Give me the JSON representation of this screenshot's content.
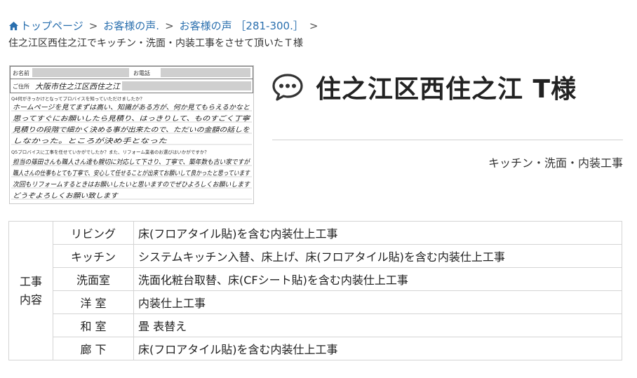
{
  "breadcrumb": {
    "items": [
      {
        "label": "トップページ"
      },
      {
        "label": "お客様の声."
      },
      {
        "label": "お客様の声 ［281-300.］"
      }
    ],
    "current": "住之江区西住之江でキッチン・洗面・内装工事をさせて頂いたＴ様"
  },
  "questionnaire": {
    "name_label": "お名前",
    "phone_label": "お電話",
    "address_label": "ご住所",
    "address_value": "大阪市住之江区西住之江",
    "q4": "Q4何がきっかけとなってプロバイスを知っていただけましたか？",
    "a4": [
      "ホームページを見てまずは高い、知識がある方が、何か見てもらえるかなと",
      "思ってすぐにお願いしたら見積り、はっきりして、ものすごく丁寧",
      "見積りの段階で細かく決める事が出来たので、ただいの金額の話しを",
      "しなかった。ところが決め手となった"
    ],
    "q5": "Q5プロバイスに工事を任せていかがでしたか？また、リフォーム業者のお選びはいかがですか？",
    "a5": [
      "担当の篠田さんも職人さん達も親切に対応して下さり、丁寧で、築年数も古い家ですが",
      "職人さんの仕事もとても丁寧で、安心して任せることが出来てお願いして良かったと思っています",
      "次回もリフォームするときはお願いしたいと思いますのでぜひよろしくお願いします",
      "どうぞよろしくお願い致します"
    ]
  },
  "voice": {
    "title": "住之江区西住之江 T様",
    "category": "キッチン・洗面・内装工事"
  },
  "work_table": {
    "group_label_line1": "工事",
    "group_label_line2": "内容",
    "rows": [
      {
        "room": "リビング",
        "detail": "床(フロアタイル貼)を含む内装仕上工事"
      },
      {
        "room": "キッチン",
        "detail": "システムキッチン入替、床上げ、床(フロアタイル貼)を含む内装仕上工事"
      },
      {
        "room": "洗面室",
        "detail": "洗面化粧台取替、床(CFシート貼)を含む内装仕上工事"
      },
      {
        "room": "洋 室",
        "detail": "内装仕上工事"
      },
      {
        "room": "和 室",
        "detail": "畳 表替え"
      },
      {
        "room": "廊 下",
        "detail": "床(フロアタイル貼)を含む内装仕上工事"
      }
    ]
  },
  "icons": {
    "home": "home-icon",
    "speech": "speech-bubble-icon"
  },
  "colors": {
    "link": "#2a6fae",
    "title": "#222222",
    "border": "#d4d4d4"
  }
}
